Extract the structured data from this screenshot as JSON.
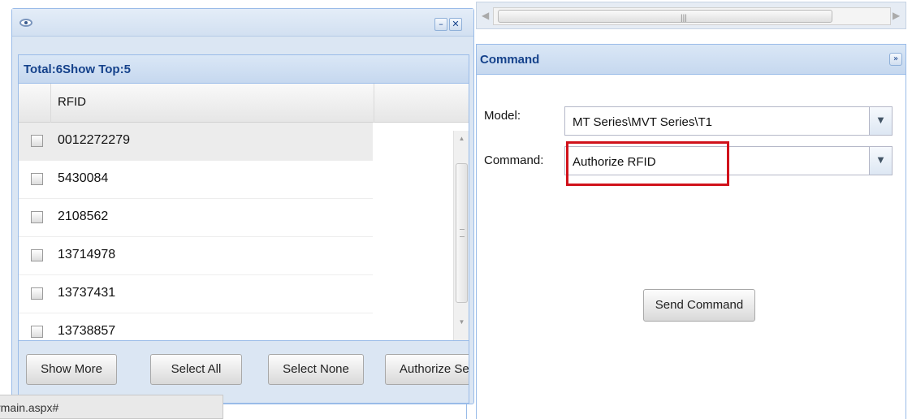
{
  "window": {
    "panel_title": "Total:6Show Top:5",
    "minimize_glyph": "–",
    "close_glyph": "✕"
  },
  "grid": {
    "column_header": "RFID",
    "rows": [
      "0012272279",
      "5430084",
      "2108562",
      "13714978",
      "13737431",
      "13738857"
    ]
  },
  "buttons": {
    "show_more": "Show More",
    "select_all": "Select All",
    "select_none": "Select None",
    "authorize_selected": "Authorize Sel"
  },
  "status_bar": {
    "text": "rmain.aspx#"
  },
  "command_panel": {
    "title": "Command",
    "collapse_glyph": "»",
    "model_label": "Model:",
    "model_value": "MT Series\\MVT Series\\T1",
    "command_label": "Command:",
    "command_value": "Authorize RFID",
    "send_button": "Send Command",
    "dropdown_glyph": "▼"
  },
  "colors": {
    "panel_header_text": "#15428b",
    "highlight_border": "#d0121b",
    "frame_border": "#99bbe8"
  },
  "icons": [
    "eye-icon",
    "minimize-icon",
    "close-icon",
    "collapse-icon",
    "dropdown-arrow-icon"
  ]
}
